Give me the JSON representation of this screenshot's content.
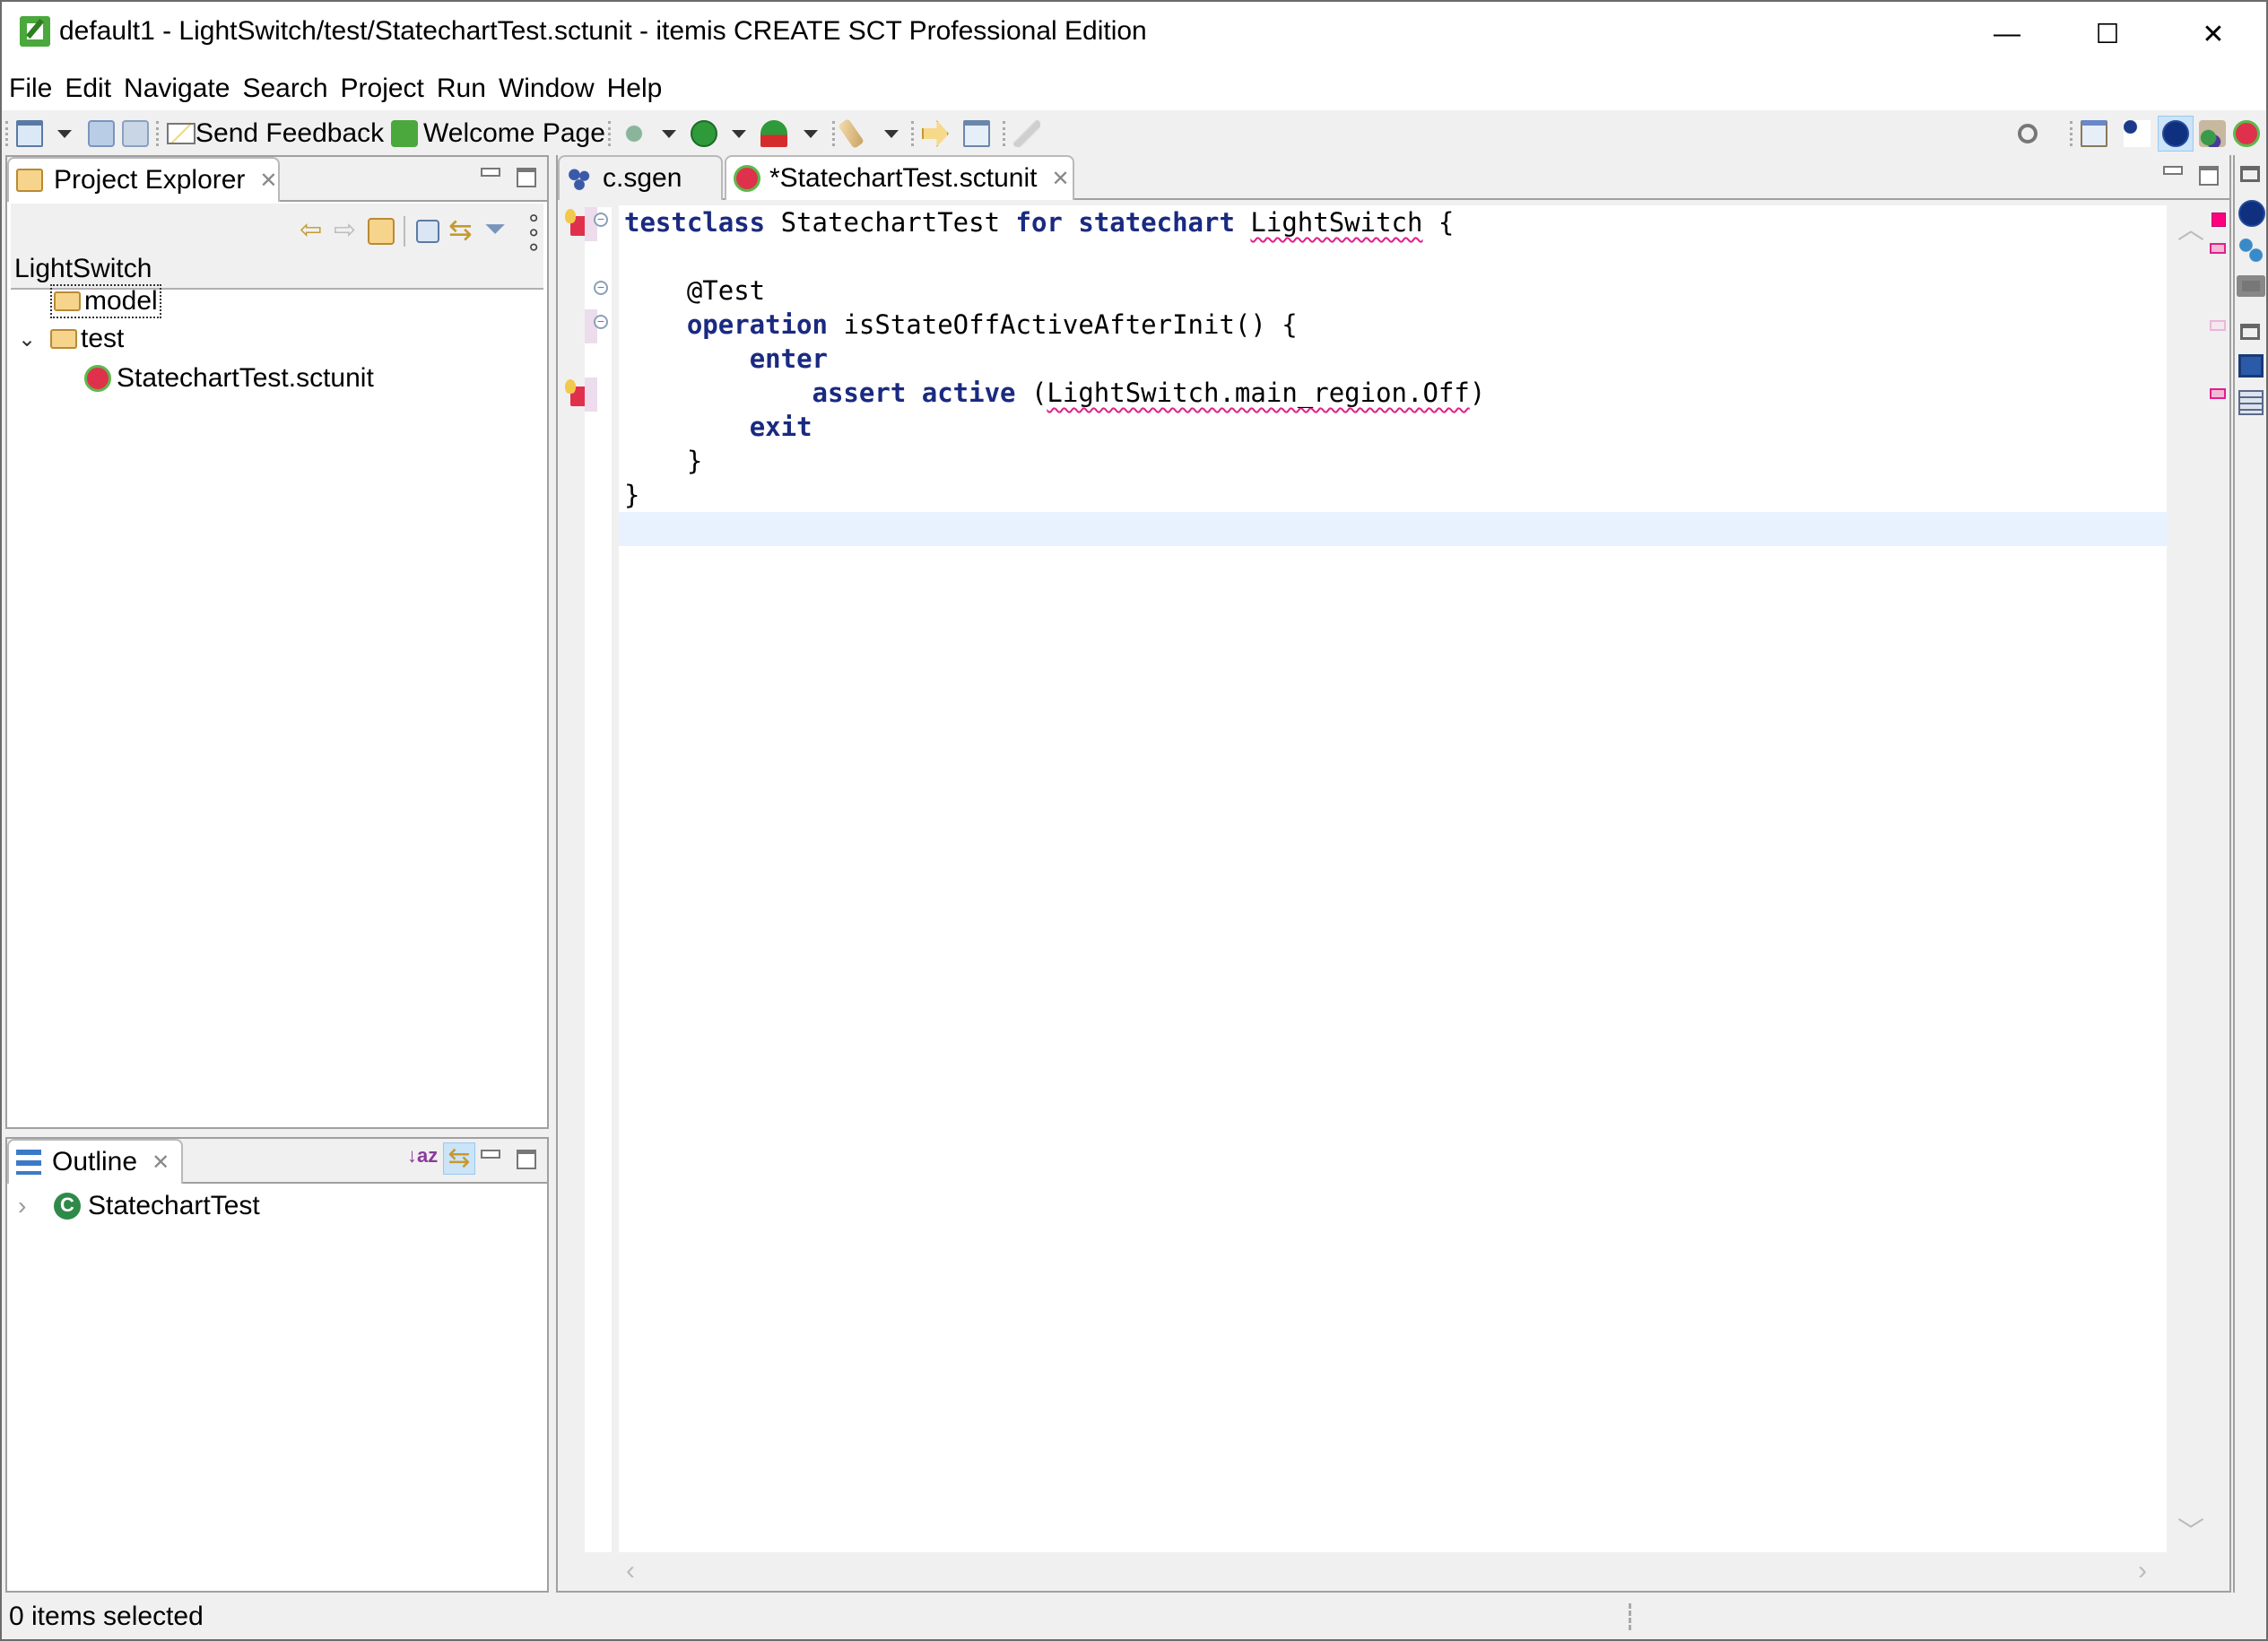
{
  "window": {
    "title": "default1 - LightSwitch/test/StatechartTest.sctunit - itemis CREATE SCT Professional Edition",
    "minimize": "—",
    "maximize": "☐",
    "close": "✕"
  },
  "menu": [
    "File",
    "Edit",
    "Navigate",
    "Search",
    "Project",
    "Run",
    "Window",
    "Help"
  ],
  "toolbar": {
    "send_feedback": "Send Feedback",
    "welcome_page": "Welcome Page",
    "icons": [
      "new-wizard-icon",
      "save-icon",
      "save-all-icon",
      "send-feedback-icon",
      "welcome-page-icon",
      "debug-icon",
      "run-icon",
      "run-external-tools-icon",
      "generate-icon",
      "next-annotation-icon",
      "pin-editor-icon",
      "edit-disabled-icon",
      "search-icon",
      "open-perspective-icon",
      "statechart-perspective-icon",
      "simulation-perspective-icon",
      "java-perspective-icon",
      "sctunit-perspective-icon"
    ]
  },
  "project_explorer": {
    "tab_label": "Project Explorer",
    "root": "LightSwitch",
    "tree": [
      {
        "label": "model",
        "type": "folder",
        "expanded": false,
        "focused": true
      },
      {
        "label": "test",
        "type": "folder",
        "expanded": true
      },
      {
        "label": "StatechartTest.sctunit",
        "type": "sctunit-file"
      }
    ]
  },
  "outline": {
    "tab_label": "Outline",
    "items": [
      {
        "label": "StatechartTest",
        "expanded": false
      }
    ]
  },
  "editor": {
    "tabs": [
      {
        "label": "c.sgen",
        "active": false
      },
      {
        "label": "*StatechartTest.sctunit",
        "active": true
      }
    ],
    "code": {
      "l1_kw1": "testclass",
      "l1_name": " StatechartTest ",
      "l1_kw2": "for statechart",
      "l1_sp": " ",
      "l1_ref": "LightSwitch",
      "l1_brace": " {",
      "l3": "    @Test",
      "l4_kw": "operation",
      "l4_rest": " isStateOffActiveAfterInit() {",
      "l5_indent": "        ",
      "l5_kw": "enter",
      "l6_indent": "            ",
      "l6_kw": "assert active",
      "l6_open": " (",
      "l6_ref": "LightSwitch.main_region.Off",
      "l6_close": ")",
      "l7_indent": "        ",
      "l7_kw": "exit",
      "l8": "    }",
      "l9": "}"
    }
  },
  "status_bar": {
    "text": "0 items selected"
  },
  "colors": {
    "keyword": "#1a2a80",
    "error_marker": "#e0208a",
    "current_line": "#e8f2fe"
  }
}
